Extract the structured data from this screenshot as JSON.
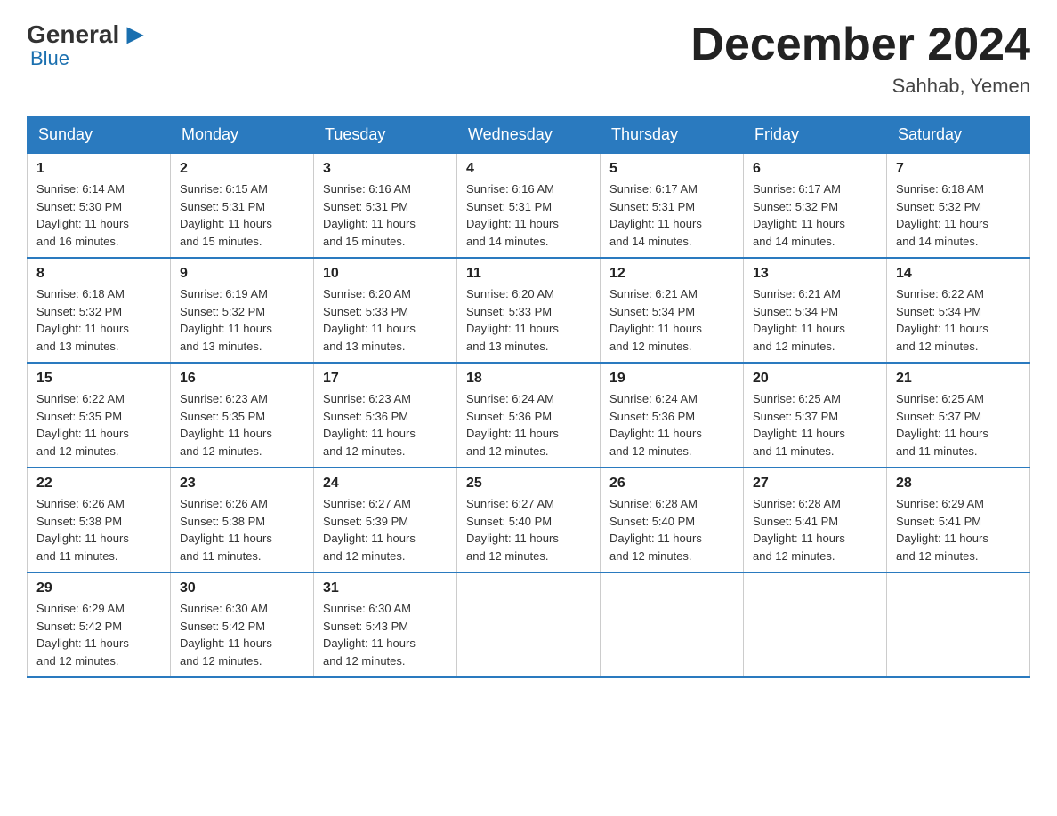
{
  "header": {
    "logo_general": "General",
    "logo_blue": "Blue",
    "month_title": "December 2024",
    "location": "Sahhab, Yemen"
  },
  "days_of_week": [
    "Sunday",
    "Monday",
    "Tuesday",
    "Wednesday",
    "Thursday",
    "Friday",
    "Saturday"
  ],
  "weeks": [
    [
      {
        "day": "1",
        "sunrise": "6:14 AM",
        "sunset": "5:30 PM",
        "daylight": "11 hours and 16 minutes."
      },
      {
        "day": "2",
        "sunrise": "6:15 AM",
        "sunset": "5:31 PM",
        "daylight": "11 hours and 15 minutes."
      },
      {
        "day": "3",
        "sunrise": "6:16 AM",
        "sunset": "5:31 PM",
        "daylight": "11 hours and 15 minutes."
      },
      {
        "day": "4",
        "sunrise": "6:16 AM",
        "sunset": "5:31 PM",
        "daylight": "11 hours and 14 minutes."
      },
      {
        "day": "5",
        "sunrise": "6:17 AM",
        "sunset": "5:31 PM",
        "daylight": "11 hours and 14 minutes."
      },
      {
        "day": "6",
        "sunrise": "6:17 AM",
        "sunset": "5:32 PM",
        "daylight": "11 hours and 14 minutes."
      },
      {
        "day": "7",
        "sunrise": "6:18 AM",
        "sunset": "5:32 PM",
        "daylight": "11 hours and 14 minutes."
      }
    ],
    [
      {
        "day": "8",
        "sunrise": "6:18 AM",
        "sunset": "5:32 PM",
        "daylight": "11 hours and 13 minutes."
      },
      {
        "day": "9",
        "sunrise": "6:19 AM",
        "sunset": "5:32 PM",
        "daylight": "11 hours and 13 minutes."
      },
      {
        "day": "10",
        "sunrise": "6:20 AM",
        "sunset": "5:33 PM",
        "daylight": "11 hours and 13 minutes."
      },
      {
        "day": "11",
        "sunrise": "6:20 AM",
        "sunset": "5:33 PM",
        "daylight": "11 hours and 13 minutes."
      },
      {
        "day": "12",
        "sunrise": "6:21 AM",
        "sunset": "5:34 PM",
        "daylight": "11 hours and 12 minutes."
      },
      {
        "day": "13",
        "sunrise": "6:21 AM",
        "sunset": "5:34 PM",
        "daylight": "11 hours and 12 minutes."
      },
      {
        "day": "14",
        "sunrise": "6:22 AM",
        "sunset": "5:34 PM",
        "daylight": "11 hours and 12 minutes."
      }
    ],
    [
      {
        "day": "15",
        "sunrise": "6:22 AM",
        "sunset": "5:35 PM",
        "daylight": "11 hours and 12 minutes."
      },
      {
        "day": "16",
        "sunrise": "6:23 AM",
        "sunset": "5:35 PM",
        "daylight": "11 hours and 12 minutes."
      },
      {
        "day": "17",
        "sunrise": "6:23 AM",
        "sunset": "5:36 PM",
        "daylight": "11 hours and 12 minutes."
      },
      {
        "day": "18",
        "sunrise": "6:24 AM",
        "sunset": "5:36 PM",
        "daylight": "11 hours and 12 minutes."
      },
      {
        "day": "19",
        "sunrise": "6:24 AM",
        "sunset": "5:36 PM",
        "daylight": "11 hours and 12 minutes."
      },
      {
        "day": "20",
        "sunrise": "6:25 AM",
        "sunset": "5:37 PM",
        "daylight": "11 hours and 11 minutes."
      },
      {
        "day": "21",
        "sunrise": "6:25 AM",
        "sunset": "5:37 PM",
        "daylight": "11 hours and 11 minutes."
      }
    ],
    [
      {
        "day": "22",
        "sunrise": "6:26 AM",
        "sunset": "5:38 PM",
        "daylight": "11 hours and 11 minutes."
      },
      {
        "day": "23",
        "sunrise": "6:26 AM",
        "sunset": "5:38 PM",
        "daylight": "11 hours and 11 minutes."
      },
      {
        "day": "24",
        "sunrise": "6:27 AM",
        "sunset": "5:39 PM",
        "daylight": "11 hours and 12 minutes."
      },
      {
        "day": "25",
        "sunrise": "6:27 AM",
        "sunset": "5:40 PM",
        "daylight": "11 hours and 12 minutes."
      },
      {
        "day": "26",
        "sunrise": "6:28 AM",
        "sunset": "5:40 PM",
        "daylight": "11 hours and 12 minutes."
      },
      {
        "day": "27",
        "sunrise": "6:28 AM",
        "sunset": "5:41 PM",
        "daylight": "11 hours and 12 minutes."
      },
      {
        "day": "28",
        "sunrise": "6:29 AM",
        "sunset": "5:41 PM",
        "daylight": "11 hours and 12 minutes."
      }
    ],
    [
      {
        "day": "29",
        "sunrise": "6:29 AM",
        "sunset": "5:42 PM",
        "daylight": "11 hours and 12 minutes."
      },
      {
        "day": "30",
        "sunrise": "6:30 AM",
        "sunset": "5:42 PM",
        "daylight": "11 hours and 12 minutes."
      },
      {
        "day": "31",
        "sunrise": "6:30 AM",
        "sunset": "5:43 PM",
        "daylight": "11 hours and 12 minutes."
      },
      null,
      null,
      null,
      null
    ]
  ],
  "labels": {
    "sunrise": "Sunrise:",
    "sunset": "Sunset:",
    "daylight": "Daylight:"
  }
}
